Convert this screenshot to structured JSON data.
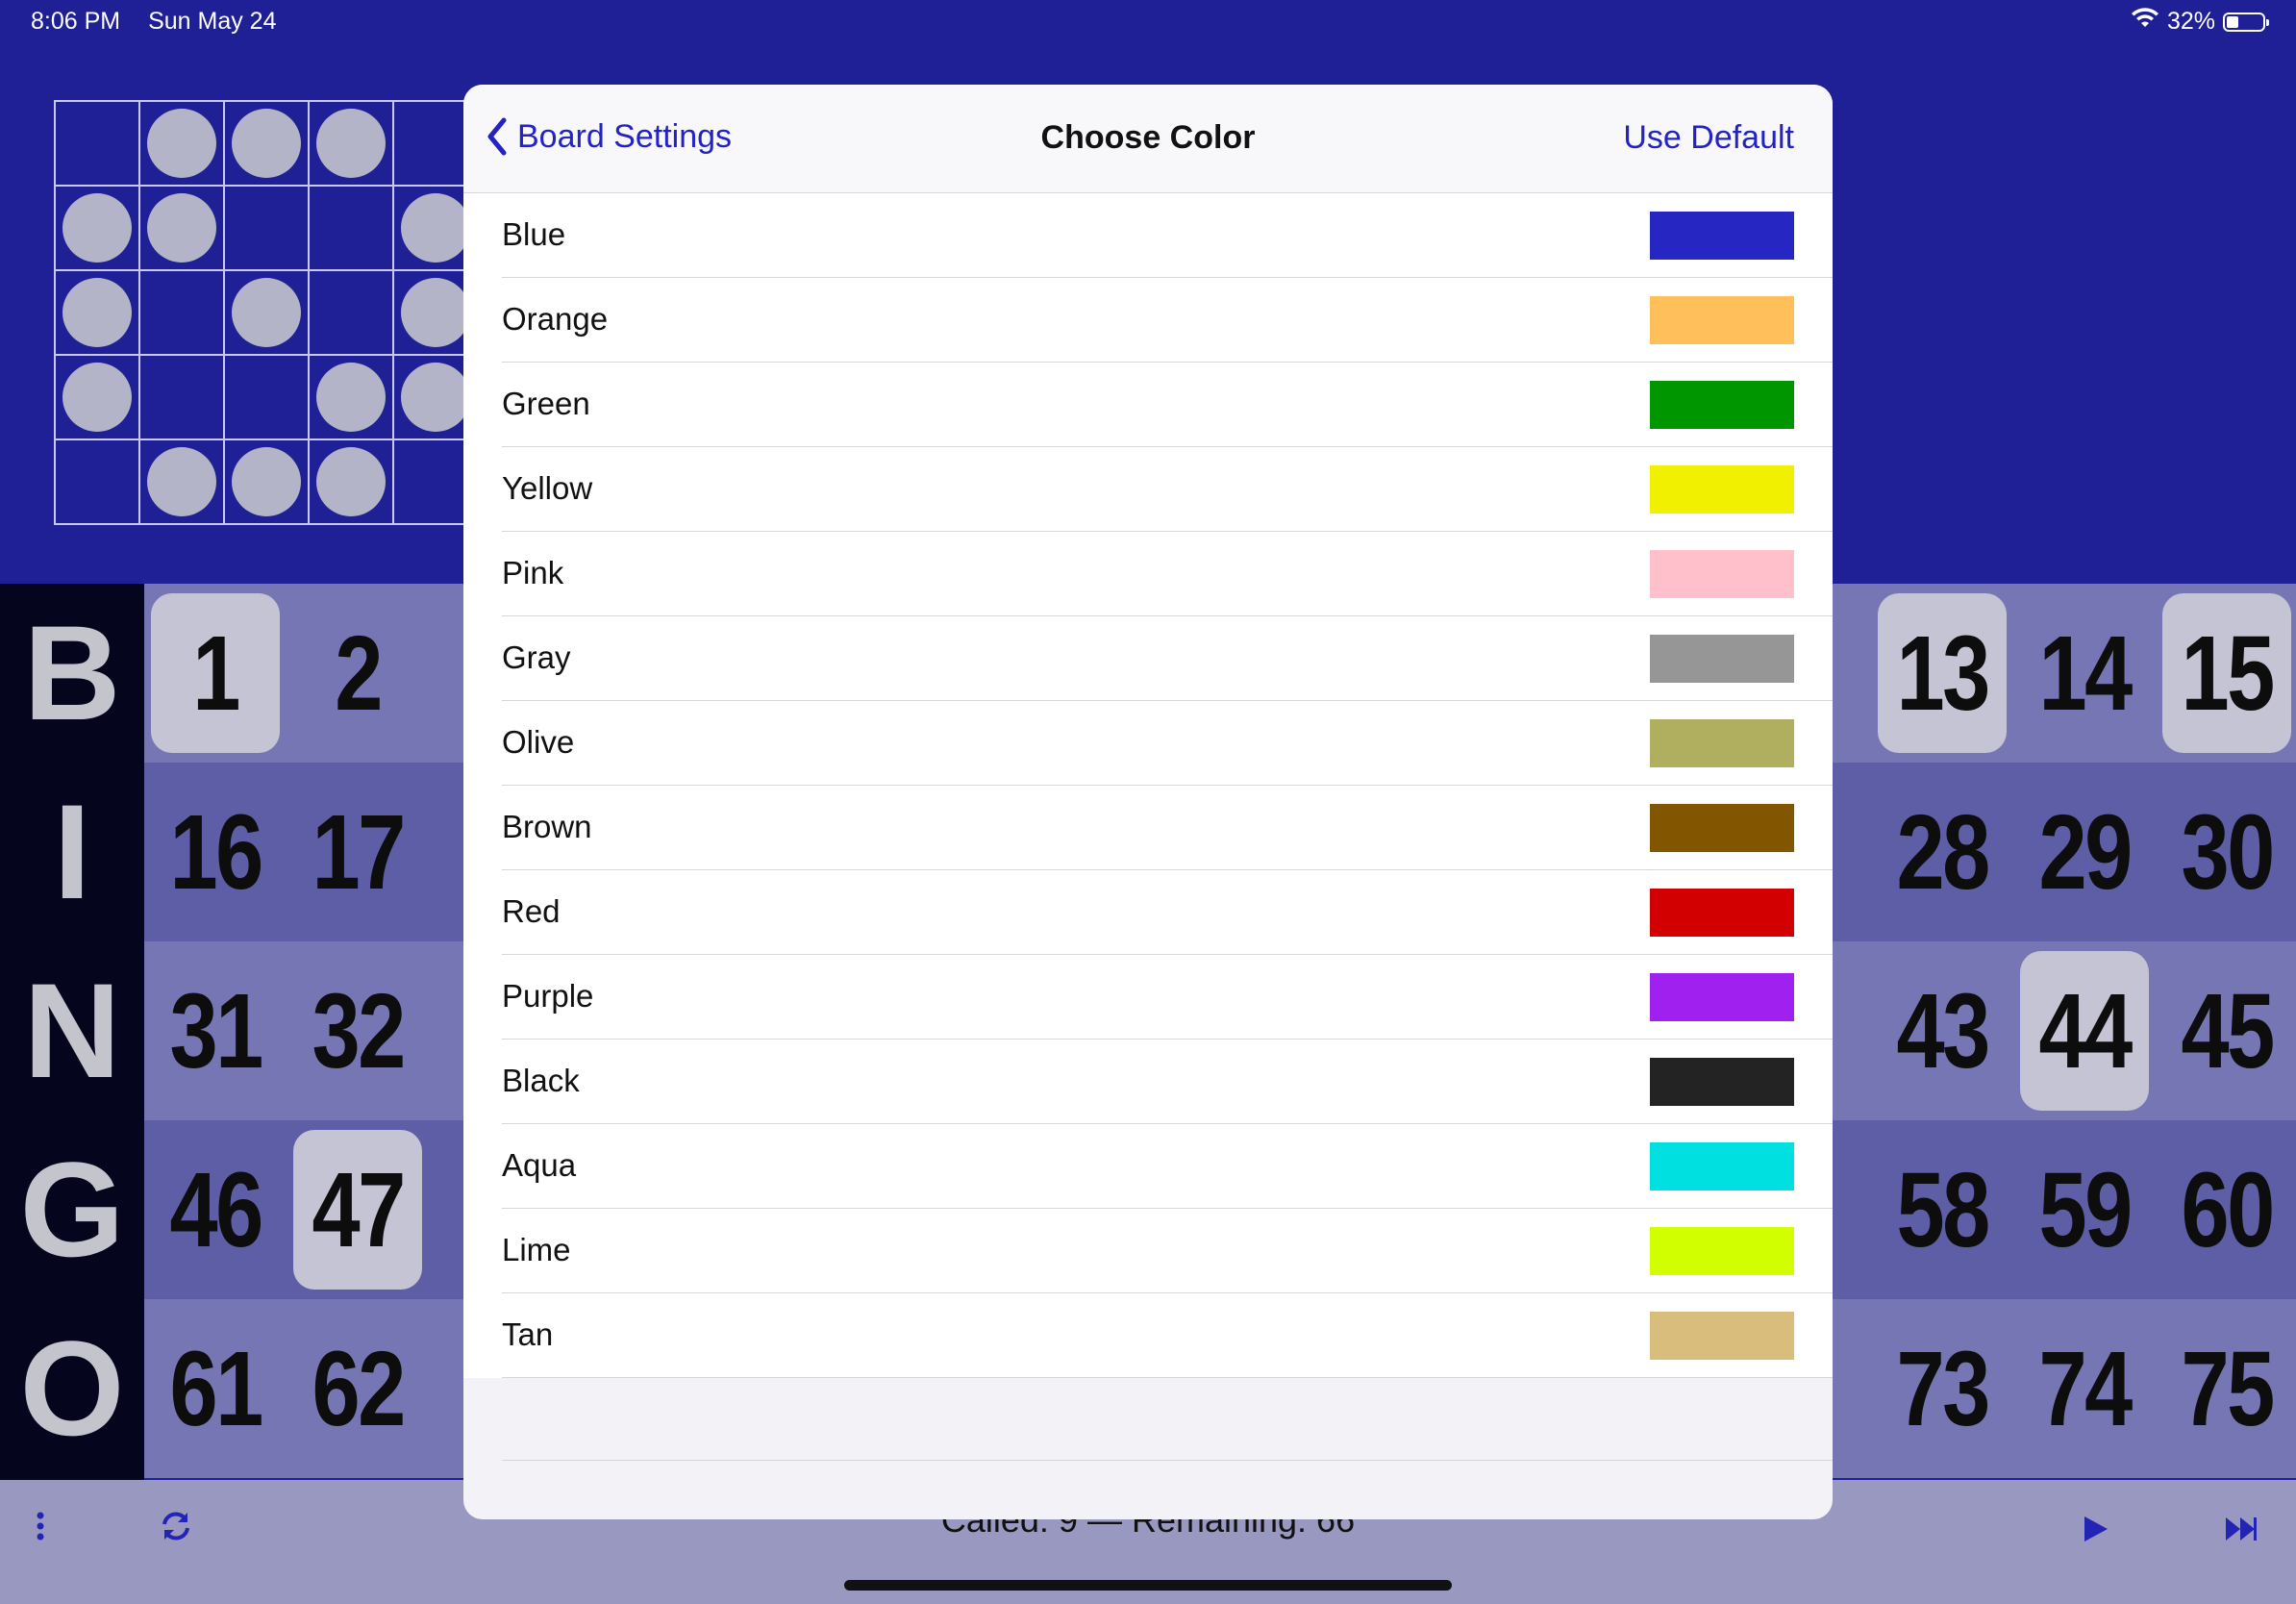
{
  "status_bar": {
    "time": "8:06 PM",
    "date": "Sun May 24",
    "battery": "32%"
  },
  "pattern": [
    [
      0,
      1,
      1,
      1,
      0
    ],
    [
      1,
      1,
      0,
      0,
      1
    ],
    [
      1,
      0,
      1,
      0,
      1
    ],
    [
      1,
      0,
      0,
      1,
      1
    ],
    [
      0,
      1,
      1,
      1,
      0
    ]
  ],
  "board": {
    "letters": [
      "B",
      "I",
      "N",
      "G",
      "O"
    ],
    "left_numbers": [
      [
        "1",
        "2"
      ],
      [
        "16",
        "17"
      ],
      [
        "31",
        "32"
      ],
      [
        "46",
        "47"
      ],
      [
        "61",
        "62"
      ]
    ],
    "right_numbers": [
      [
        "13",
        "14",
        "15"
      ],
      [
        "28",
        "29",
        "30"
      ],
      [
        "43",
        "44",
        "45"
      ],
      [
        "58",
        "59",
        "60"
      ],
      [
        "73",
        "74",
        "75"
      ]
    ],
    "called": [
      "1",
      "13",
      "15",
      "44",
      "47"
    ]
  },
  "toolbar": {
    "called_text": "Called: 9 — Remaining: 66"
  },
  "modal": {
    "back_label": "Board Settings",
    "title": "Choose Color",
    "use_default_label": "Use Default",
    "colors": [
      {
        "name": "Blue",
        "hex": "#2626c2"
      },
      {
        "name": "Orange",
        "hex": "#ffc05c"
      },
      {
        "name": "Green",
        "hex": "#009600"
      },
      {
        "name": "Yellow",
        "hex": "#f0f000"
      },
      {
        "name": "Pink",
        "hex": "#ffc0cb"
      },
      {
        "name": "Gray",
        "hex": "#969696"
      },
      {
        "name": "Olive",
        "hex": "#afaf5f"
      },
      {
        "name": "Brown",
        "hex": "#825500"
      },
      {
        "name": "Red",
        "hex": "#d20000"
      },
      {
        "name": "Purple",
        "hex": "#a020f0"
      },
      {
        "name": "Black",
        "hex": "#232323"
      },
      {
        "name": "Aqua",
        "hex": "#00e0e0"
      },
      {
        "name": "Lime",
        "hex": "#d2ff00"
      },
      {
        "name": "Tan",
        "hex": "#d9bd7d"
      }
    ]
  },
  "theme": {
    "background": "#1f1f96",
    "accent": "#2323c4"
  }
}
